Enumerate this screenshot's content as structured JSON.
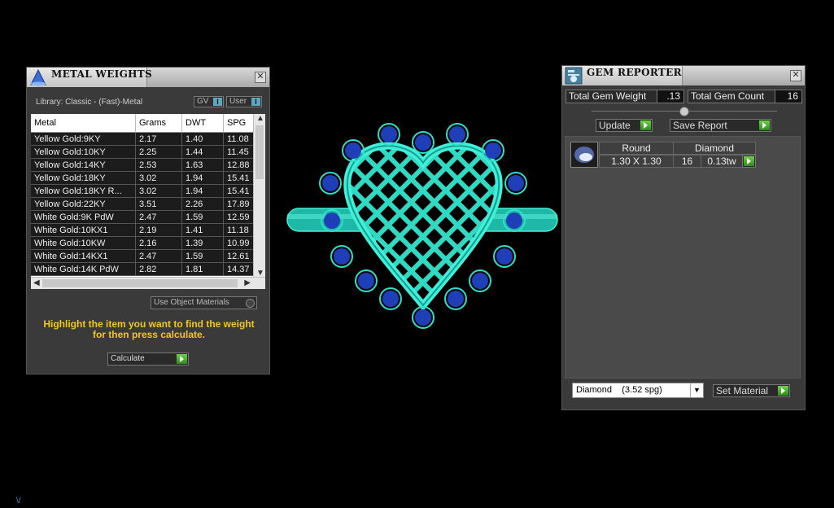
{
  "metal_weights": {
    "title": "METAL WEIGHTS",
    "library": "Library: Classic - (Fast)-Metal",
    "gv_label": "GV",
    "user_label": "User",
    "toggle_glyph": "I",
    "columns": [
      "Metal",
      "Grams",
      "DWT",
      "SPG"
    ],
    "rows": [
      [
        "Yellow Gold:9KY",
        "2.17",
        "1.40",
        "11.08"
      ],
      [
        "Yellow Gold:10KY",
        "2.25",
        "1.44",
        "11.45"
      ],
      [
        "Yellow Gold:14KY",
        "2.53",
        "1.63",
        "12.88"
      ],
      [
        "Yellow Gold:18KY",
        "3.02",
        "1.94",
        "15.41"
      ],
      [
        "Yellow Gold:18KY R...",
        "3.02",
        "1.94",
        "15.41"
      ],
      [
        "Yellow Gold:22KY",
        "3.51",
        "2.26",
        "17.89"
      ],
      [
        "White Gold:9K PdW",
        "2.47",
        "1.59",
        "12.59"
      ],
      [
        "White Gold:10KX1",
        "2.19",
        "1.41",
        "11.18"
      ],
      [
        "White Gold:10KW",
        "2.16",
        "1.39",
        "10.99"
      ],
      [
        "White Gold:14KX1",
        "2.47",
        "1.59",
        "12.61"
      ],
      [
        "White Gold:14K PdW",
        "2.82",
        "1.81",
        "14.37"
      ]
    ],
    "use_object_materials": "Use Object Materials",
    "hint": "Highlight the item you want to find the weight for then press calculate.",
    "calculate_label": "Calculate"
  },
  "gem_reporter": {
    "title": "GEM REPORTER",
    "total_weight_label": "Total Gem Weight",
    "total_weight_value": ".13",
    "total_count_label": "Total Gem Count",
    "total_count_value": "16",
    "update_label": "Update",
    "save_report_label": "Save Report",
    "gem": {
      "shape": "Round",
      "material": "Diamond",
      "size": "1.30 X 1.30",
      "count": "16",
      "weight": "0.13tw"
    },
    "material_select": "Diamond    (3.52 spg)",
    "set_material_label": "Set Material"
  },
  "colors": {
    "metal": "#2fe0c8",
    "gem": "#1f3fb8",
    "accent_green": "#4cb531",
    "hint_yellow": "#f3c623"
  },
  "corner_glyph": "\\/"
}
